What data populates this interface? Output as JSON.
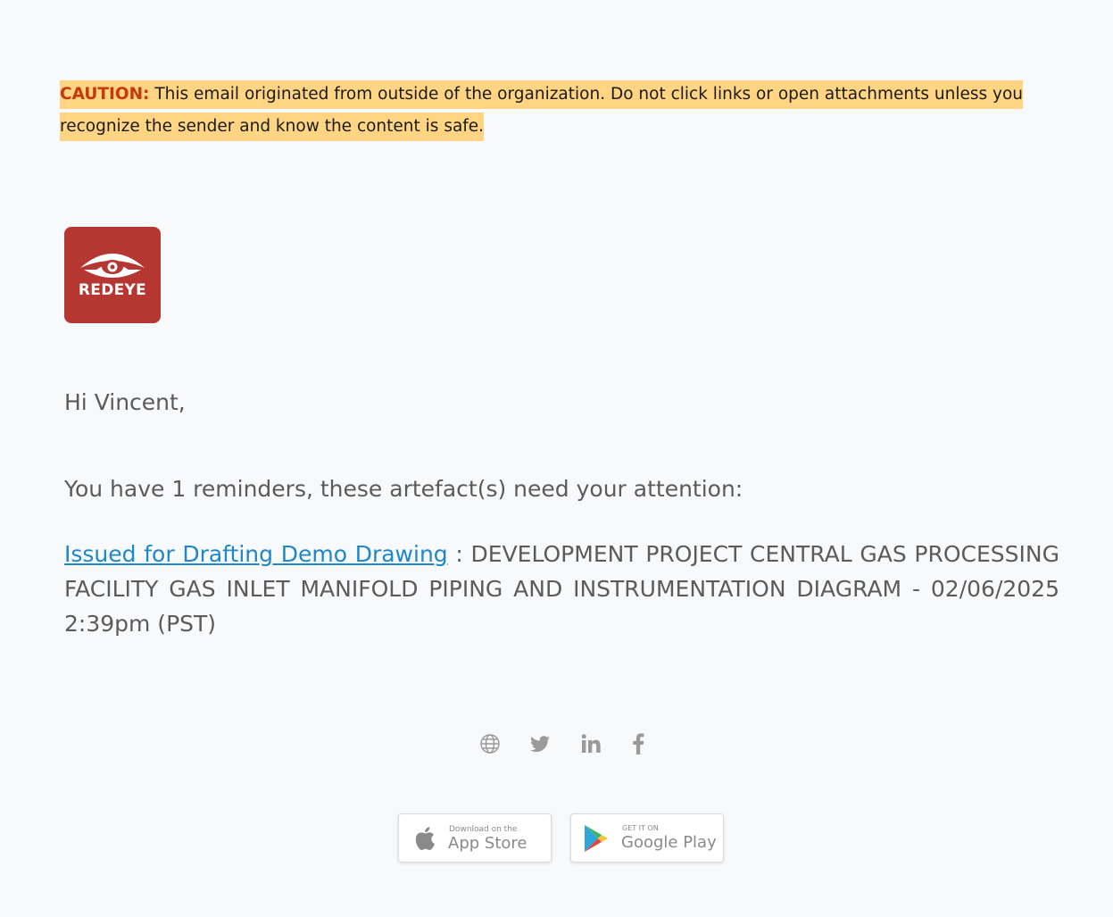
{
  "caution": {
    "label": "CAUTION:",
    "text": "This email originated from outside of the organization. Do not click links or open attachments unless you recognize the sender and know the content is safe."
  },
  "logo": {
    "text": "REDEYE",
    "color": "#b63632"
  },
  "greeting": "Hi Vincent,",
  "intro": "You have 1 reminders, these artefact(s) need your attention:",
  "reminder": {
    "link_text": "Issued for Drafting Demo Drawing",
    "description": " : DEVELOPMENT PROJECT CENTRAL GAS PROCESSING FACILITY GAS INLET MANIFOLD PIPING AND INSTRUMENTATION DIAGRAM - 02/06/2025 2:39pm (PST)"
  },
  "social_icons": [
    "globe-icon",
    "twitter-icon",
    "linkedin-icon",
    "facebook-icon"
  ],
  "app_store": {
    "small": "Download on the",
    "big": "App Store"
  },
  "google_play": {
    "small": "GET IT ON",
    "big": "Google Play"
  },
  "colors": {
    "background": "#f8f9fb",
    "caution_highlight": "#ffd583",
    "caution_label": "#c6390c",
    "link": "#1f87c7",
    "body_text": "#5b5b5b",
    "icon_gray": "#9a9a9a"
  }
}
